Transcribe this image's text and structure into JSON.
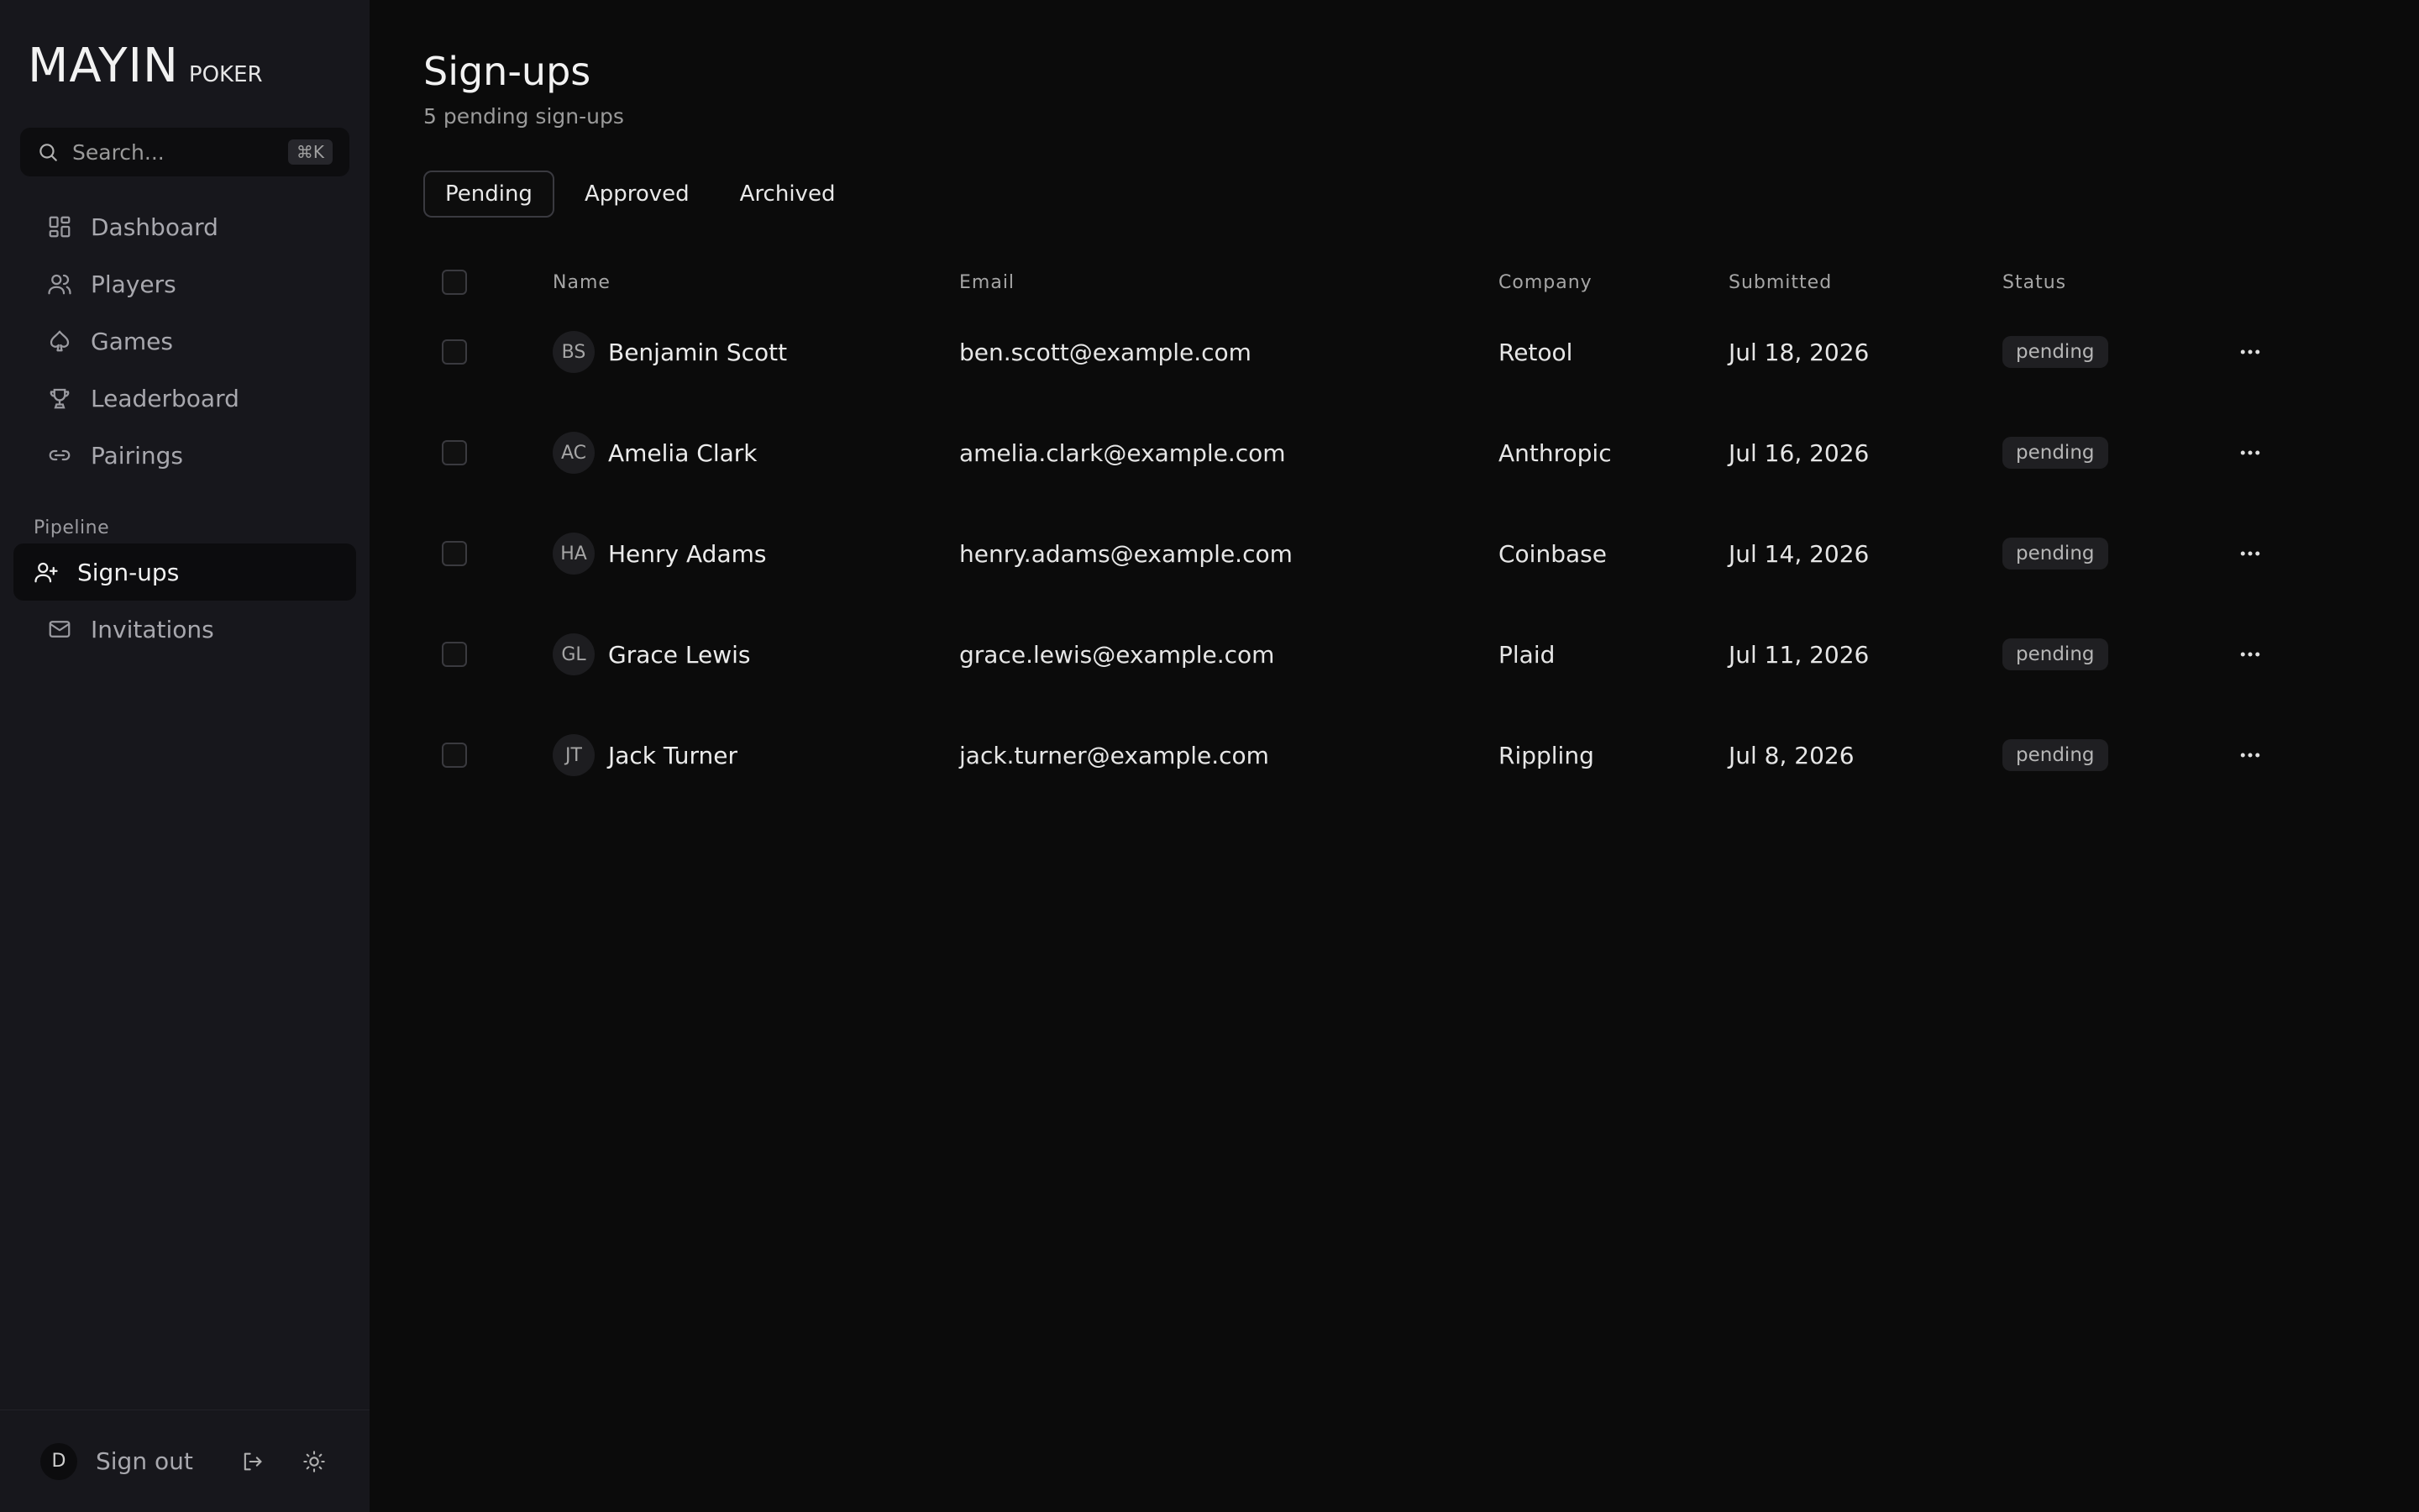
{
  "brand": {
    "main": "MAYIN",
    "sub": "POKER"
  },
  "search": {
    "placeholder": "Search...",
    "shortcut": "⌘K"
  },
  "nav": {
    "items": [
      {
        "label": "Dashboard",
        "icon": "grid-icon"
      },
      {
        "label": "Players",
        "icon": "users-icon"
      },
      {
        "label": "Games",
        "icon": "spade-icon"
      },
      {
        "label": "Leaderboard",
        "icon": "trophy-icon"
      },
      {
        "label": "Pairings",
        "icon": "link-icon"
      }
    ],
    "section_label": "Pipeline",
    "pipeline_items": [
      {
        "label": "Sign-ups",
        "icon": "user-plus-icon",
        "active": true
      },
      {
        "label": "Invitations",
        "icon": "mail-icon"
      }
    ]
  },
  "footer": {
    "avatar_initial": "D",
    "signout_label": "Sign out"
  },
  "page": {
    "title": "Sign-ups",
    "subtitle": "5 pending sign-ups"
  },
  "tabs": [
    {
      "label": "Pending",
      "active": true
    },
    {
      "label": "Approved"
    },
    {
      "label": "Archived"
    }
  ],
  "table": {
    "headers": {
      "name": "Name",
      "email": "Email",
      "company": "Company",
      "submitted": "Submitted",
      "status": "Status"
    },
    "rows": [
      {
        "initials": "BS",
        "name": "Benjamin Scott",
        "email": "ben.scott@example.com",
        "company": "Retool",
        "submitted": "Jul 18, 2026",
        "status": "pending"
      },
      {
        "initials": "AC",
        "name": "Amelia Clark",
        "email": "amelia.clark@example.com",
        "company": "Anthropic",
        "submitted": "Jul 16, 2026",
        "status": "pending"
      },
      {
        "initials": "HA",
        "name": "Henry Adams",
        "email": "henry.adams@example.com",
        "company": "Coinbase",
        "submitted": "Jul 14, 2026",
        "status": "pending"
      },
      {
        "initials": "GL",
        "name": "Grace Lewis",
        "email": "grace.lewis@example.com",
        "company": "Plaid",
        "submitted": "Jul 11, 2026",
        "status": "pending"
      },
      {
        "initials": "JT",
        "name": "Jack Turner",
        "email": "jack.turner@example.com",
        "company": "Rippling",
        "submitted": "Jul 8, 2026",
        "status": "pending"
      }
    ]
  },
  "colors": {
    "sidebar_bg": "#17171c",
    "main_bg": "#0b0b0b",
    "badge_bg": "#1f1f22"
  }
}
